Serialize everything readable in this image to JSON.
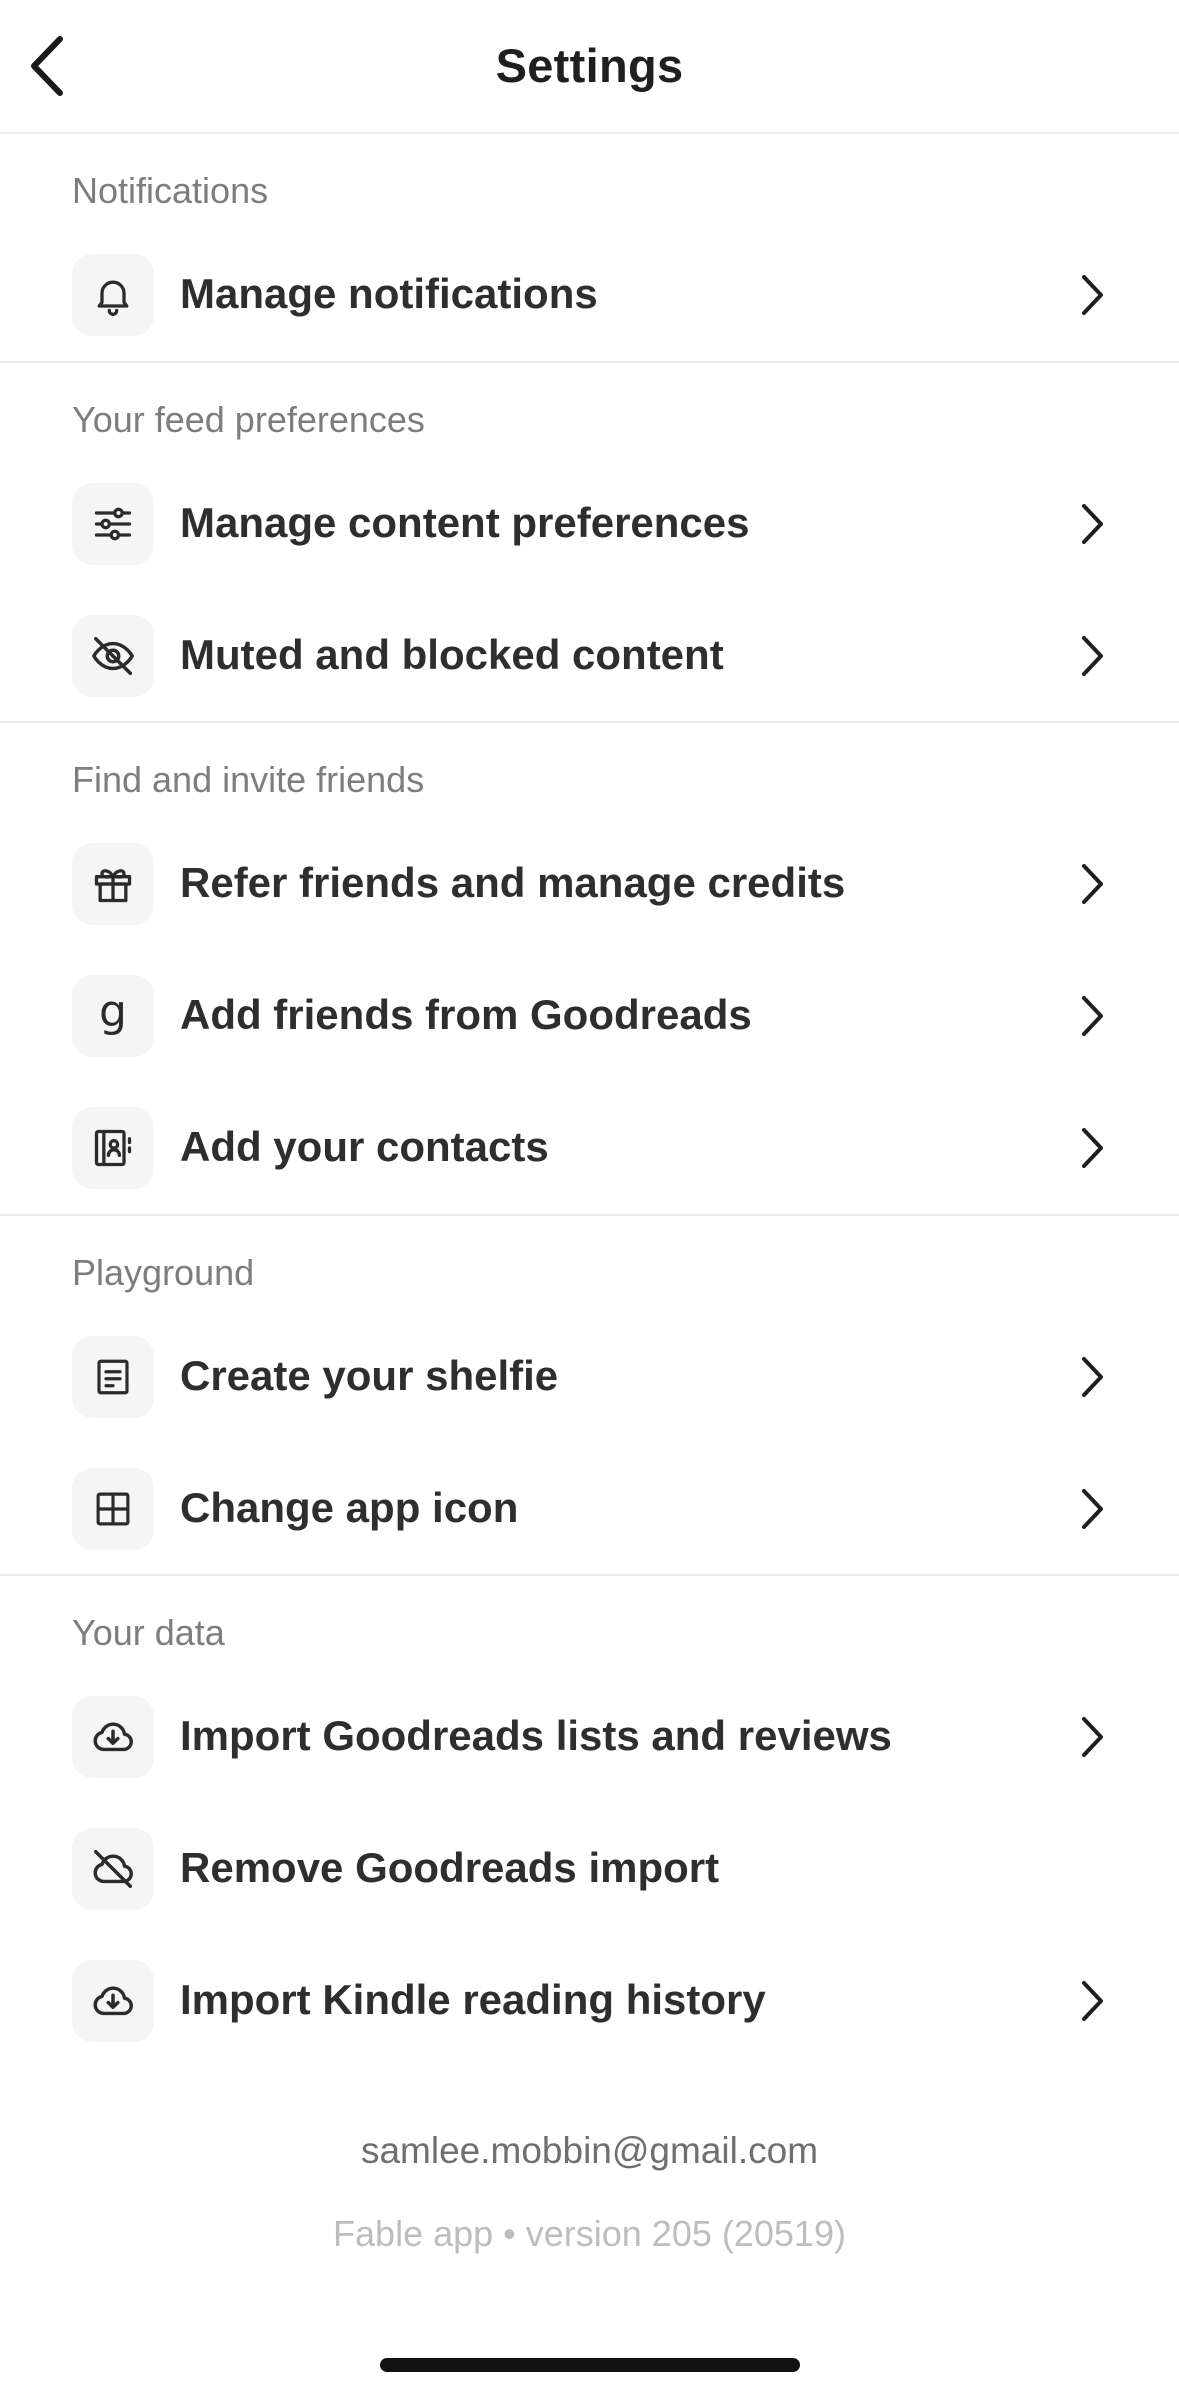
{
  "header": {
    "title": "Settings"
  },
  "sections": [
    {
      "title": "Notifications",
      "items": [
        {
          "label": "Manage notifications",
          "icon": "bell-icon",
          "chevron": true
        }
      ]
    },
    {
      "title": "Your feed preferences",
      "items": [
        {
          "label": "Manage content preferences",
          "icon": "sliders-icon",
          "chevron": true
        },
        {
          "label": "Muted and blocked content",
          "icon": "eye-off-icon",
          "chevron": true
        }
      ]
    },
    {
      "title": "Find and invite friends",
      "items": [
        {
          "label": "Refer friends and manage credits",
          "icon": "gift-icon",
          "chevron": true
        },
        {
          "label": "Add friends from Goodreads",
          "icon": "goodreads-icon",
          "icon_glyph": "g",
          "chevron": true
        },
        {
          "label": "Add your contacts",
          "icon": "contacts-icon",
          "chevron": true
        }
      ]
    },
    {
      "title": "Playground",
      "items": [
        {
          "label": "Create your shelfie",
          "icon": "document-icon",
          "chevron": true
        },
        {
          "label": "Change app icon",
          "icon": "grid-icon",
          "chevron": true
        }
      ]
    },
    {
      "title": "Your data",
      "items": [
        {
          "label": "Import Goodreads lists and reviews",
          "icon": "cloud-download-icon",
          "chevron": true
        },
        {
          "label": "Remove Goodreads import",
          "icon": "cloud-off-icon",
          "chevron": false
        },
        {
          "label": "Import Kindle reading history",
          "icon": "cloud-download-icon",
          "chevron": true
        }
      ]
    }
  ],
  "footer": {
    "email": "samlee.mobbin@gmail.com",
    "version": "Fable app • version 205 (20519)"
  }
}
